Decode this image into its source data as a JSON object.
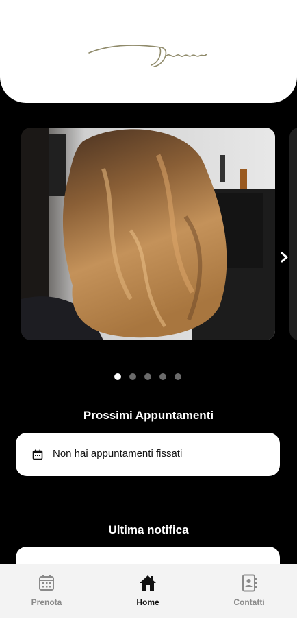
{
  "header": {
    "logo_icon": "signature-logo"
  },
  "carousel": {
    "slides_count": 5,
    "active_index": 0,
    "next_arrow_icon": "chevron-right-icon"
  },
  "appointments": {
    "title": "Prossimi Appuntamenti",
    "empty_message": "Non hai appuntamenti fissati",
    "icon": "calendar-icon"
  },
  "notification": {
    "title": "Ultima notifica"
  },
  "tabbar": {
    "items": [
      {
        "label": "Prenota",
        "icon": "calendar-icon",
        "active": false
      },
      {
        "label": "Home",
        "icon": "home-icon",
        "active": true
      },
      {
        "label": "Contatti",
        "icon": "contact-book-icon",
        "active": false
      }
    ]
  },
  "colors": {
    "background": "#000000",
    "card": "#ffffff",
    "logo": "#8f8a6a",
    "tab_inactive": "#8a8a8a",
    "tab_active": "#111111"
  }
}
